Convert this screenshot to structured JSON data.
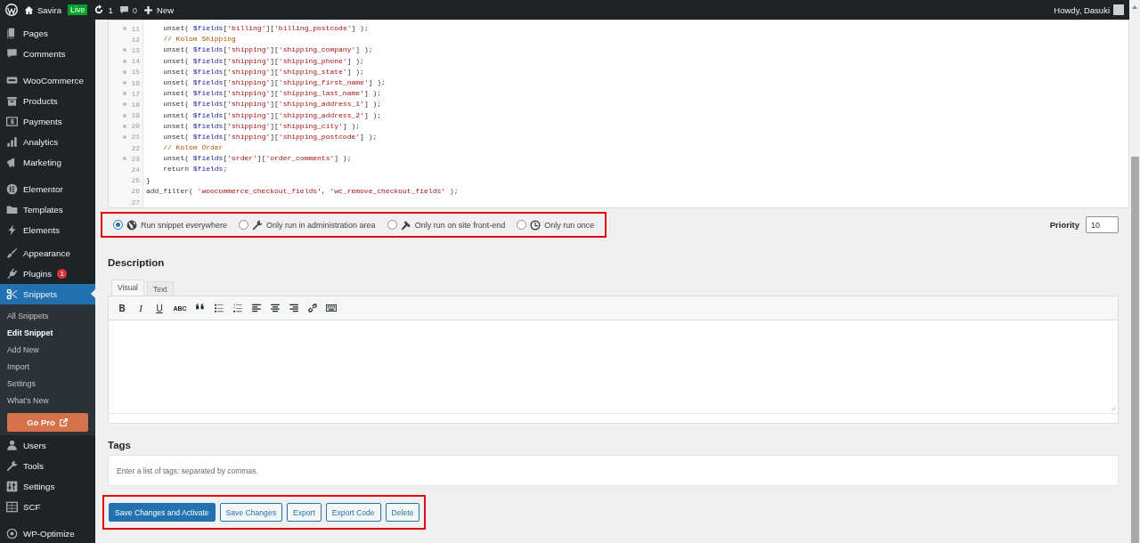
{
  "admin_bar": {
    "site_name": "Savira",
    "live_badge": "Live",
    "updates_count": "1",
    "comments_count": "0",
    "new_label": "New",
    "greeting": "Howdy, Dasuki"
  },
  "sidebar": {
    "groups": [
      [
        {
          "label": "Pages",
          "selected": false
        },
        {
          "label": "Comments",
          "selected": false
        }
      ],
      [
        {
          "label": "WooCommerce",
          "selected": false
        },
        {
          "label": "Products",
          "selected": false
        },
        {
          "label": "Payments",
          "selected": false
        },
        {
          "label": "Analytics",
          "selected": false
        },
        {
          "label": "Marketing",
          "selected": false
        }
      ],
      [
        {
          "label": "Elementor",
          "selected": false
        },
        {
          "label": "Templates",
          "selected": false
        },
        {
          "label": "Elements",
          "selected": false
        }
      ],
      [
        {
          "label": "Appearance",
          "selected": false
        },
        {
          "label": "Plugins",
          "selected": false,
          "badge": "1"
        },
        {
          "label": "Snippets",
          "selected": true,
          "submenu": [
            {
              "label": "All Snippets",
              "selected": false
            },
            {
              "label": "Edit Snippet",
              "selected": true
            },
            {
              "label": "Add New",
              "selected": false
            },
            {
              "label": "Import",
              "selected": false
            },
            {
              "label": "Settings",
              "selected": false
            },
            {
              "label": "What's New",
              "selected": false
            }
          ],
          "go_pro": "Go Pro"
        },
        {
          "label": "Users",
          "selected": false
        },
        {
          "label": "Tools",
          "selected": false
        },
        {
          "label": "Settings",
          "selected": false
        },
        {
          "label": "SCF",
          "selected": false
        }
      ],
      [
        {
          "label": "WP-Optimize",
          "selected": false
        }
      ]
    ]
  },
  "code": {
    "lines": [
      {
        "number": "11",
        "foldable": true,
        "tokens": [
          {
            "kind": "plain",
            "text": "    unset( "
          },
          {
            "kind": "variable",
            "text": "$fields"
          },
          {
            "kind": "plain",
            "text": "["
          },
          {
            "kind": "string",
            "text": "'billing'"
          },
          {
            "kind": "plain",
            "text": "]["
          },
          {
            "kind": "string",
            "text": "'billing_postcode'"
          },
          {
            "kind": "plain",
            "text": "] );"
          }
        ]
      },
      {
        "number": "12",
        "foldable": false,
        "tokens": [
          {
            "kind": "comment",
            "text": "    // Kolom Shipping"
          }
        ]
      },
      {
        "number": "13",
        "foldable": true,
        "tokens": [
          {
            "kind": "plain",
            "text": "    unset( "
          },
          {
            "kind": "variable",
            "text": "$fields"
          },
          {
            "kind": "plain",
            "text": "["
          },
          {
            "kind": "string",
            "text": "'shipping'"
          },
          {
            "kind": "plain",
            "text": "]["
          },
          {
            "kind": "string",
            "text": "'shipping_company'"
          },
          {
            "kind": "plain",
            "text": "] );"
          }
        ]
      },
      {
        "number": "14",
        "foldable": true,
        "tokens": [
          {
            "kind": "plain",
            "text": "    unset( "
          },
          {
            "kind": "variable",
            "text": "$fields"
          },
          {
            "kind": "plain",
            "text": "["
          },
          {
            "kind": "string",
            "text": "'shipping'"
          },
          {
            "kind": "plain",
            "text": "]["
          },
          {
            "kind": "string",
            "text": "'shipping_phone'"
          },
          {
            "kind": "plain",
            "text": "] );"
          }
        ]
      },
      {
        "number": "15",
        "foldable": true,
        "tokens": [
          {
            "kind": "plain",
            "text": "    unset( "
          },
          {
            "kind": "variable",
            "text": "$fields"
          },
          {
            "kind": "plain",
            "text": "["
          },
          {
            "kind": "string",
            "text": "'shipping'"
          },
          {
            "kind": "plain",
            "text": "]["
          },
          {
            "kind": "string",
            "text": "'shipping_state'"
          },
          {
            "kind": "plain",
            "text": "] );"
          }
        ]
      },
      {
        "number": "16",
        "foldable": true,
        "tokens": [
          {
            "kind": "plain",
            "text": "    unset( "
          },
          {
            "kind": "variable",
            "text": "$fields"
          },
          {
            "kind": "plain",
            "text": "["
          },
          {
            "kind": "string",
            "text": "'shipping'"
          },
          {
            "kind": "plain",
            "text": "]["
          },
          {
            "kind": "string",
            "text": "'shipping_first_name'"
          },
          {
            "kind": "plain",
            "text": "] );"
          }
        ]
      },
      {
        "number": "17",
        "foldable": true,
        "tokens": [
          {
            "kind": "plain",
            "text": "    unset( "
          },
          {
            "kind": "variable",
            "text": "$fields"
          },
          {
            "kind": "plain",
            "text": "["
          },
          {
            "kind": "string",
            "text": "'shipping'"
          },
          {
            "kind": "plain",
            "text": "]["
          },
          {
            "kind": "string",
            "text": "'shipping_last_name'"
          },
          {
            "kind": "plain",
            "text": "] );"
          }
        ]
      },
      {
        "number": "18",
        "foldable": true,
        "tokens": [
          {
            "kind": "plain",
            "text": "    unset( "
          },
          {
            "kind": "variable",
            "text": "$fields"
          },
          {
            "kind": "plain",
            "text": "["
          },
          {
            "kind": "string",
            "text": "'shipping'"
          },
          {
            "kind": "plain",
            "text": "]["
          },
          {
            "kind": "string",
            "text": "'shipping_address_1'"
          },
          {
            "kind": "plain",
            "text": "] );"
          }
        ]
      },
      {
        "number": "19",
        "foldable": true,
        "tokens": [
          {
            "kind": "plain",
            "text": "    unset( "
          },
          {
            "kind": "variable",
            "text": "$fields"
          },
          {
            "kind": "plain",
            "text": "["
          },
          {
            "kind": "string",
            "text": "'shipping'"
          },
          {
            "kind": "plain",
            "text": "]["
          },
          {
            "kind": "string",
            "text": "'shipping_address_2'"
          },
          {
            "kind": "plain",
            "text": "] );"
          }
        ]
      },
      {
        "number": "20",
        "foldable": true,
        "tokens": [
          {
            "kind": "plain",
            "text": "    unset( "
          },
          {
            "kind": "variable",
            "text": "$fields"
          },
          {
            "kind": "plain",
            "text": "["
          },
          {
            "kind": "string",
            "text": "'shipping'"
          },
          {
            "kind": "plain",
            "text": "]["
          },
          {
            "kind": "string",
            "text": "'shipping_city'"
          },
          {
            "kind": "plain",
            "text": "] );"
          }
        ]
      },
      {
        "number": "21",
        "foldable": true,
        "tokens": [
          {
            "kind": "plain",
            "text": "    unset( "
          },
          {
            "kind": "variable",
            "text": "$fields"
          },
          {
            "kind": "plain",
            "text": "["
          },
          {
            "kind": "string",
            "text": "'shipping'"
          },
          {
            "kind": "plain",
            "text": "]["
          },
          {
            "kind": "string",
            "text": "'shipping_postcode'"
          },
          {
            "kind": "plain",
            "text": "] );"
          }
        ]
      },
      {
        "number": "22",
        "foldable": false,
        "tokens": [
          {
            "kind": "comment",
            "text": "    // Kolom Order"
          }
        ]
      },
      {
        "number": "23",
        "foldable": true,
        "tokens": [
          {
            "kind": "plain",
            "text": "    unset( "
          },
          {
            "kind": "variable",
            "text": "$fields"
          },
          {
            "kind": "plain",
            "text": "["
          },
          {
            "kind": "string",
            "text": "'order'"
          },
          {
            "kind": "plain",
            "text": "]["
          },
          {
            "kind": "string",
            "text": "'order_comments'"
          },
          {
            "kind": "plain",
            "text": "] );"
          }
        ]
      },
      {
        "number": "24",
        "foldable": false,
        "tokens": [
          {
            "kind": "plain",
            "text": "    return "
          },
          {
            "kind": "variable",
            "text": "$fields"
          },
          {
            "kind": "plain",
            "text": ";"
          }
        ]
      },
      {
        "number": "25",
        "foldable": false,
        "tokens": [
          {
            "kind": "plain",
            "text": "}"
          }
        ]
      },
      {
        "number": "26",
        "foldable": false,
        "tokens": [
          {
            "kind": "plain",
            "text": "add_filter( "
          },
          {
            "kind": "string",
            "text": "'woocommerce_checkout_fields'"
          },
          {
            "kind": "plain",
            "text": ", "
          },
          {
            "kind": "string",
            "text": "'wc_remove_checkout_fields'"
          },
          {
            "kind": "plain",
            "text": " );"
          }
        ]
      },
      {
        "number": "27",
        "foldable": false
      }
    ]
  },
  "run_scope": {
    "highlighted": true,
    "options": [
      {
        "label": "Run snippet everywhere",
        "selected": true
      },
      {
        "label": "Only run in administration area",
        "selected": false
      },
      {
        "label": "Only run on site front-end",
        "selected": false
      },
      {
        "label": "Only run once",
        "selected": false
      }
    ]
  },
  "priority": {
    "label": "Priority",
    "value": "10"
  },
  "description": {
    "heading": "Description",
    "tabs": [
      {
        "label": "Visual",
        "selected": true
      },
      {
        "label": "Text",
        "selected": false
      }
    ],
    "toolbar": [
      {
        "kind": "bold",
        "label": "B"
      },
      {
        "kind": "italic",
        "label": "I"
      },
      {
        "kind": "underline",
        "label": "U"
      },
      {
        "kind": "strikethrough",
        "label": "ABC"
      },
      {
        "kind": "quote"
      },
      {
        "kind": "bullet-list"
      },
      {
        "kind": "numbered-list"
      },
      {
        "kind": "align-left"
      },
      {
        "kind": "align-center"
      },
      {
        "kind": "align-right"
      },
      {
        "kind": "link"
      },
      {
        "kind": "keyboard"
      }
    ]
  },
  "tags": {
    "heading": "Tags",
    "placeholder": "Enter a list of tags: separated by commas."
  },
  "actions": {
    "highlighted": true,
    "buttons": [
      {
        "label": "Save Changes and Activate",
        "kind": "primary"
      },
      {
        "label": "Save Changes",
        "kind": "secondary"
      },
      {
        "label": "Export",
        "kind": "secondary"
      },
      {
        "label": "Export Code",
        "kind": "secondary"
      },
      {
        "label": "Delete",
        "kind": "secondary"
      }
    ]
  }
}
